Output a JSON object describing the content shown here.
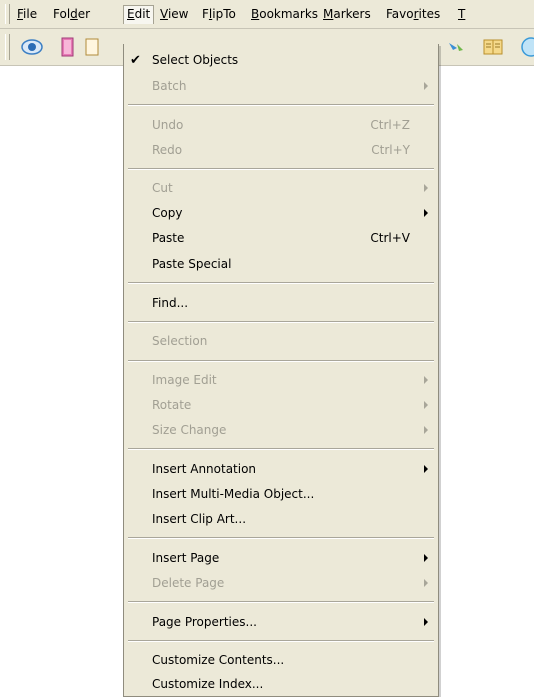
{
  "menubar": {
    "items": [
      {
        "pre": "",
        "mn": "F",
        "post": "ile"
      },
      {
        "pre": "Fol",
        "mn": "d",
        "post": "er"
      },
      {
        "pre": "",
        "mn": "E",
        "post": "dit"
      },
      {
        "pre": "",
        "mn": "V",
        "post": "iew"
      },
      {
        "pre": "F",
        "mn": "l",
        "post": "ipTo"
      },
      {
        "pre": "",
        "mn": "B",
        "post": "ookmarks"
      },
      {
        "pre": "",
        "mn": "M",
        "post": "arkers"
      },
      {
        "pre": "Favo",
        "mn": "r",
        "post": "ites"
      },
      {
        "pre": "",
        "mn": "T",
        "post": ""
      }
    ]
  },
  "toolbar": {
    "icons": [
      "eye-icon",
      "pink-card-icon",
      "document-icon",
      "arrow-icon",
      "contents-icon",
      "circle-icon"
    ]
  },
  "edit_menu": {
    "select_objects": "Select Objects",
    "checkmark": "✔",
    "batch": "Batch",
    "undo": "Undo",
    "undo_shortcut": "Ctrl+Z",
    "redo": "Redo",
    "redo_shortcut": "Ctrl+Y",
    "cut": "Cut",
    "copy": "Copy",
    "paste": "Paste",
    "paste_shortcut": "Ctrl+V",
    "paste_special": "Paste Special",
    "find": "Find...",
    "selection": "Selection",
    "image_edit": "Image Edit",
    "rotate": "Rotate",
    "size_change": "Size Change",
    "insert_annotation": "Insert Annotation",
    "insert_multimedia": "Insert Multi-Media Object...",
    "insert_clip_art": "Insert Clip Art...",
    "insert_page": "Insert Page",
    "delete_page": "Delete Page",
    "page_properties": "Page Properties...",
    "customize_contents": "Customize Contents...",
    "customize_index": "Customize Index..."
  },
  "colors": {
    "menu_bg": "#ece9d8",
    "disabled_text": "#a19f93"
  }
}
